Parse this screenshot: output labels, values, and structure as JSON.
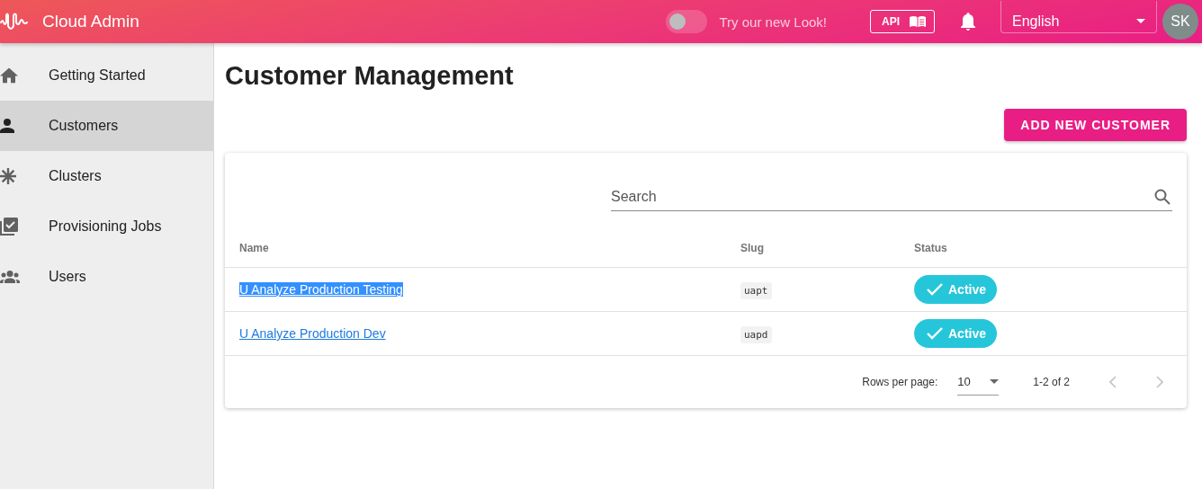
{
  "header": {
    "title": "Cloud Admin",
    "toggle": {
      "label": "Try our new Look!",
      "on": false
    },
    "api_button": "API",
    "locale": {
      "value": "English"
    },
    "avatar": "SK"
  },
  "sidebar": {
    "items": [
      {
        "label": "Getting Started",
        "selected": false
      },
      {
        "label": "Customers",
        "selected": true
      },
      {
        "label": "Clusters",
        "selected": false
      },
      {
        "label": "Provisioning Jobs",
        "selected": false
      },
      {
        "label": "Users",
        "selected": false
      }
    ]
  },
  "page": {
    "title": "Customer Management",
    "add_button": "ADD NEW CUSTOMER"
  },
  "search": {
    "placeholder": "Search"
  },
  "table": {
    "columns": [
      "Name",
      "Slug",
      "Status"
    ],
    "rows": [
      {
        "name": "U Analyze Production Testing",
        "text_selected": true,
        "slug": "uapt",
        "status": "Active"
      },
      {
        "name": "U Analyze Production Dev",
        "text_selected": false,
        "slug": "uapd",
        "status": "Active"
      }
    ]
  },
  "pagination": {
    "rows_per_page_label": "Rows per page:",
    "rows_per_page": "10",
    "range": "1-2 of 2",
    "prev_disabled": true,
    "next_disabled": true
  }
}
